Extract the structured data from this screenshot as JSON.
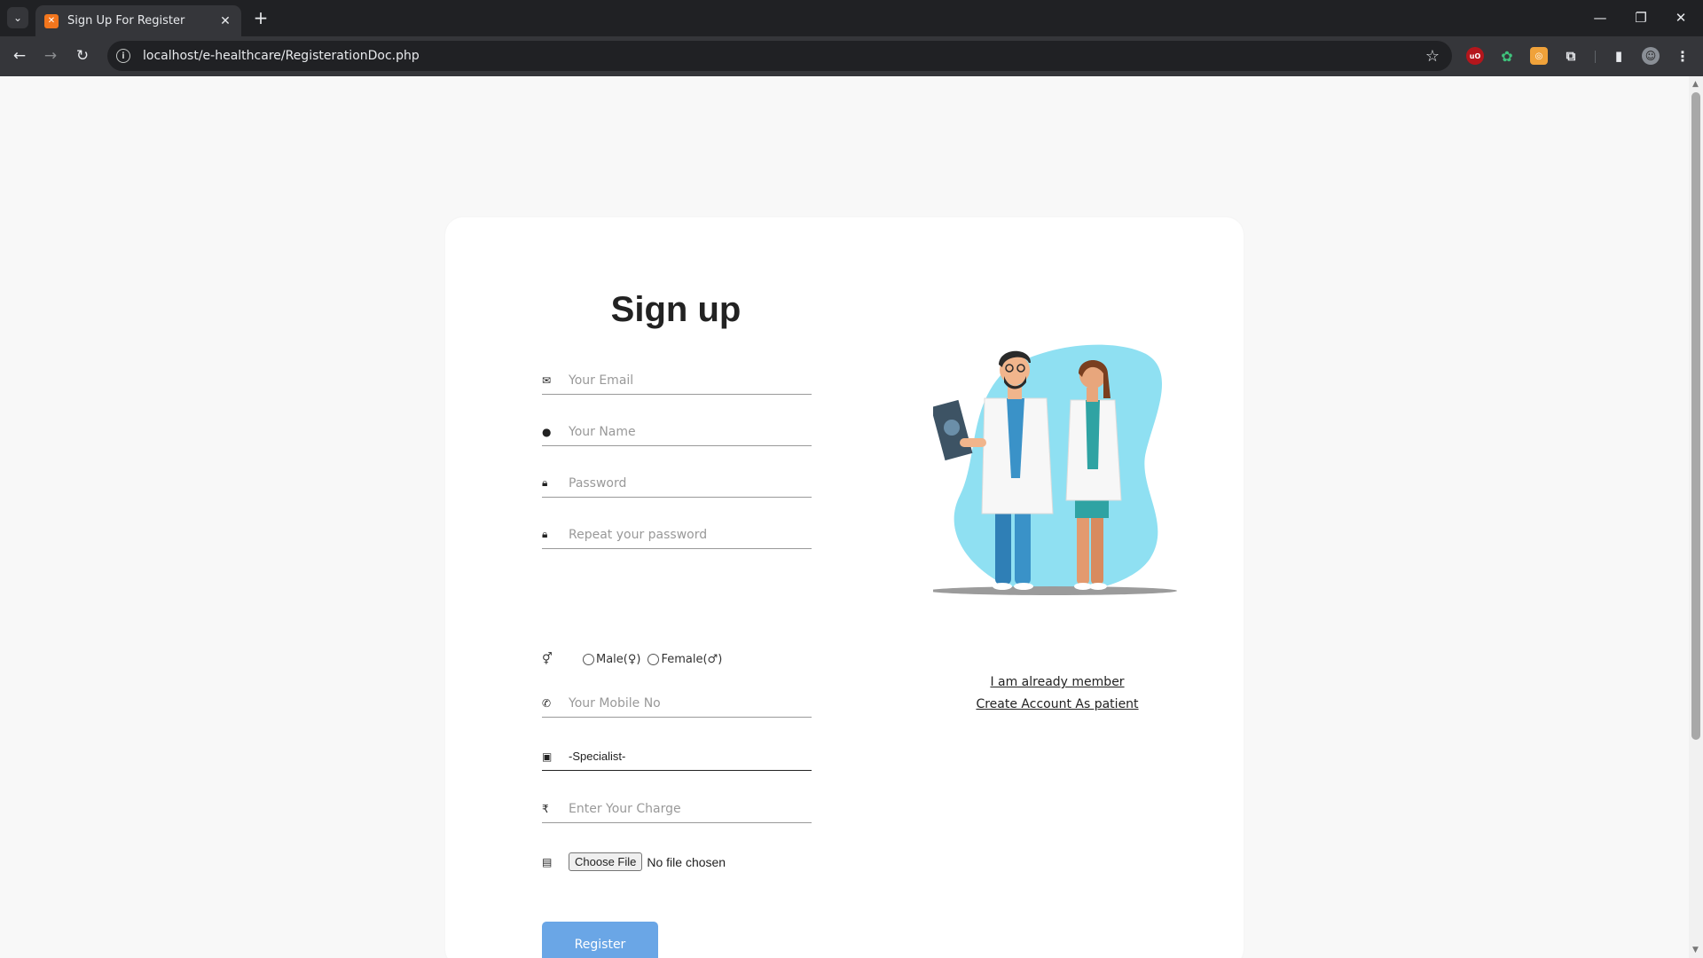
{
  "browser": {
    "tab_title": "Sign Up For Register",
    "url": "localhost/e-healthcare/RegisterationDoc.php"
  },
  "form": {
    "title": "Sign up",
    "email_placeholder": "Your Email",
    "name_placeholder": "Your Name",
    "password_placeholder": "Password",
    "repeat_password_placeholder": "Repeat your password",
    "gender": {
      "male_label": "Male(♀)",
      "female_label": "Female(♂)"
    },
    "mobile_placeholder": "Your Mobile No",
    "specialist_value": "-Specialist-",
    "charge_placeholder": "Enter Your Charge",
    "file": {
      "button_label": "Choose File",
      "status": "No file chosen"
    },
    "register_label": "Register"
  },
  "links": {
    "member": "I am already member",
    "patient": "Create Account As patient"
  },
  "colors": {
    "register_button": "#6aa6e6",
    "illustration_blob": "#8fe0f2"
  }
}
